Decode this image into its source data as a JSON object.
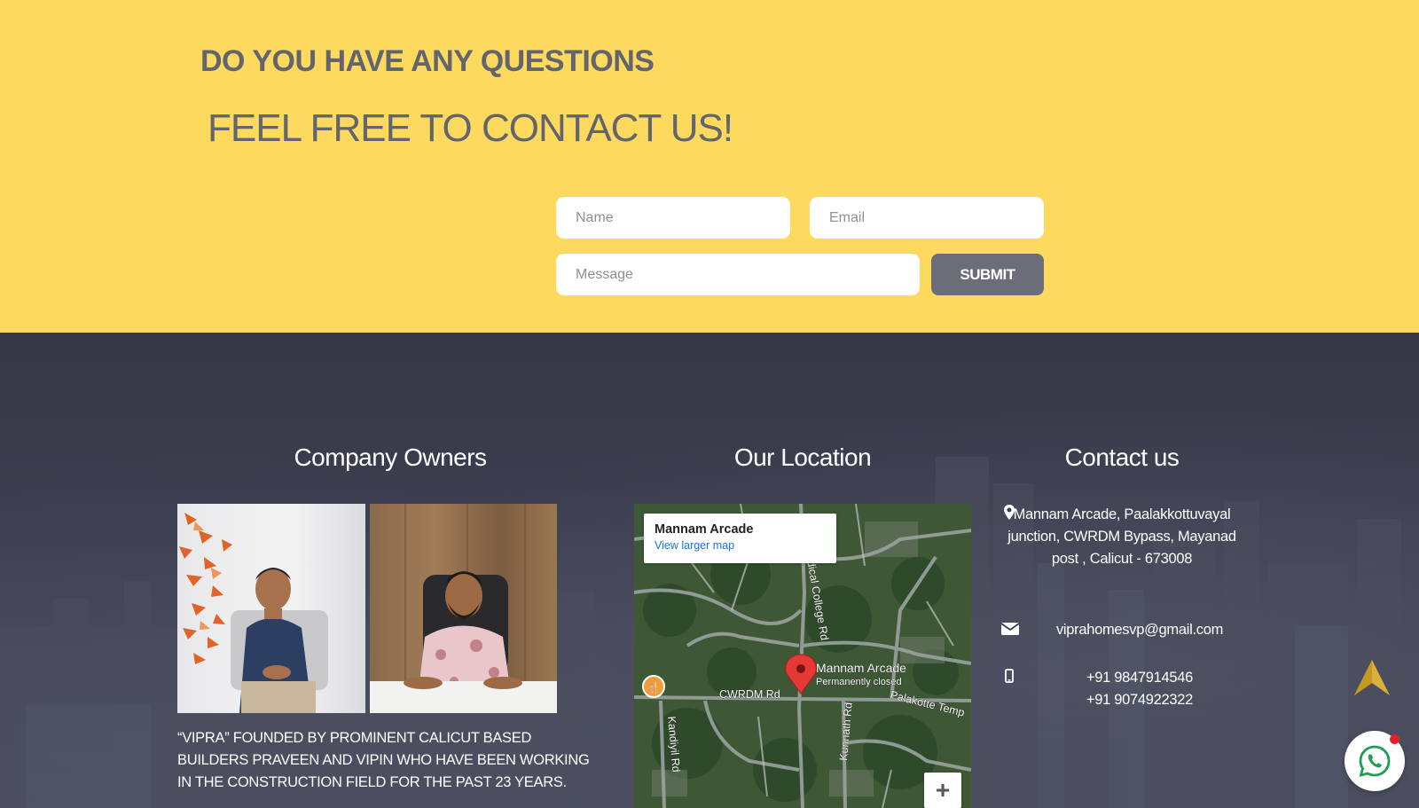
{
  "contact": {
    "heading": "DO YOU HAVE ANY QUESTIONS",
    "subheading": "FEEL FREE TO CONTACT US!",
    "name_placeholder": "Name",
    "email_placeholder": "Email",
    "message_placeholder": "Message",
    "submit_label": "SUBMIT"
  },
  "footer": {
    "owners": {
      "title": "Company Owners",
      "description": "“VIPRA” FOUNDED BY PROMINENT CALICUT BASED BUILDERS PRAVEEN AND VIPIN WHO HAVE BEEN WORKING IN THE CONSTRUCTION FIELD FOR THE PAST 23 YEARS."
    },
    "location": {
      "title": "Our Location",
      "map_place": "Mannam Arcade",
      "map_link": "View larger map",
      "pin_label": "Mannam Arcade",
      "pin_status": "Permanently closed",
      "roads": [
        "CWRDM Rd",
        "Palakotte Temp",
        "edical College Rd",
        "Kandiyil Rd",
        "Kunnath Rd"
      ],
      "zoom_label": "+"
    },
    "contact": {
      "title": "Contact us",
      "address": "Mannam Arcade, Paalakkottuvayal junction, CWRDM Bypass, Mayanad post , Calicut - 673008",
      "email": "viprahomesvp@gmail.com",
      "phone_1": "+91 9847914546",
      "phone_2": "+91 9074922322",
      "icons": [
        "map-pin-icon",
        "envelope-icon",
        "mobile-phone-icon"
      ]
    }
  },
  "floating": {
    "scroll_top_icon": "arrow-up-icon",
    "whatsapp_icon": "whatsapp-icon",
    "accent_gold": "#d9b13a",
    "whatsapp_color": "#1f9e53",
    "notify_color": "#e8202a"
  },
  "colors": {
    "band_yellow": "#fdd95e",
    "heading_gray": "#62646e",
    "button_gray": "#6b6e78",
    "footer_dark": "#3a3d4c"
  }
}
